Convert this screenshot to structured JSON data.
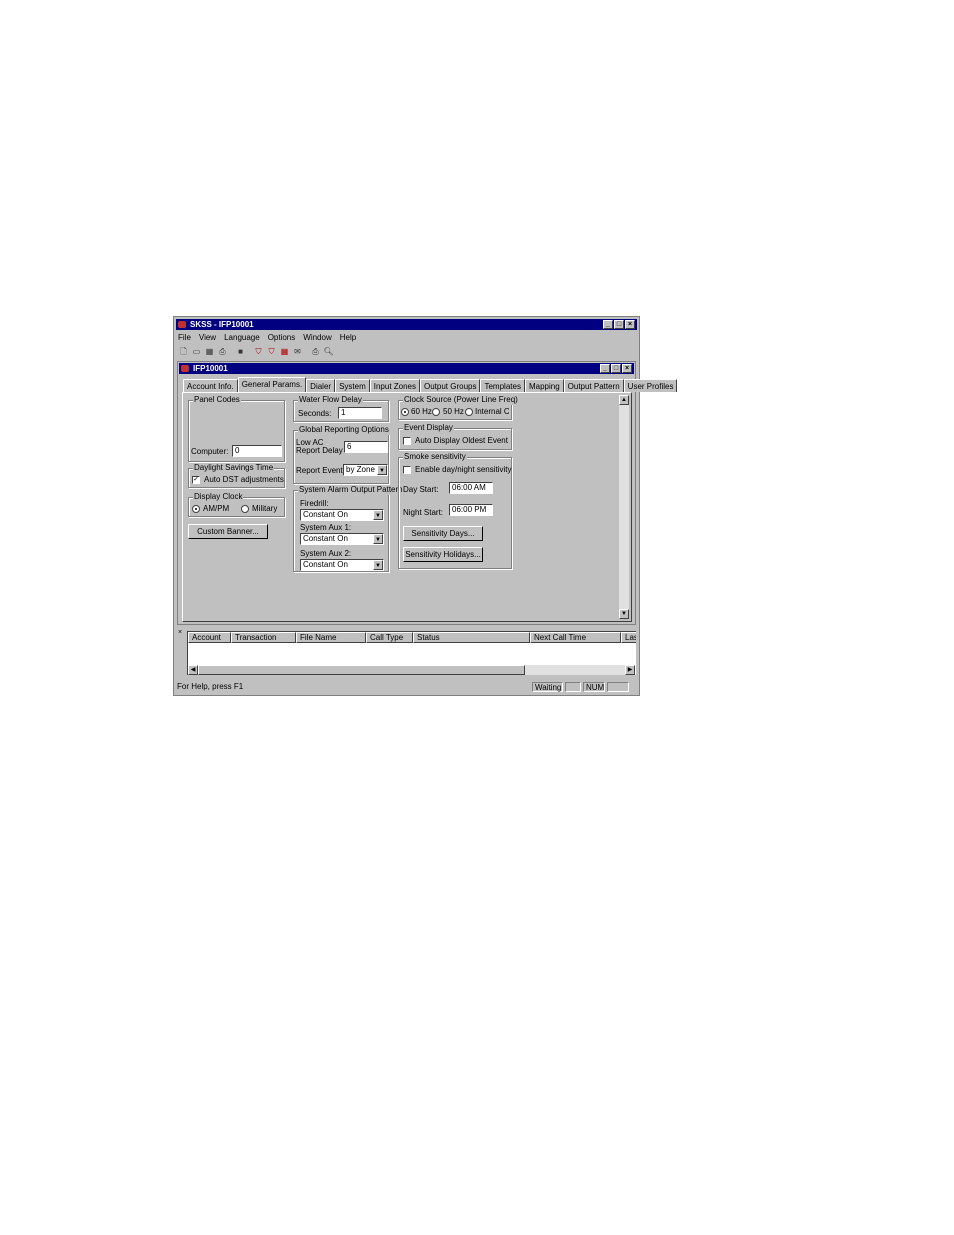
{
  "app": {
    "title": "SKSS - IFP10001",
    "window_buttons": [
      "_",
      "□",
      "×"
    ]
  },
  "menu": [
    "File",
    "View",
    "Language",
    "Options",
    "Window",
    "Help"
  ],
  "child": {
    "title": "IFP10001",
    "tabs": [
      "Account Info.",
      "General Params.",
      "Dialer",
      "System",
      "Input Zones",
      "Output Groups",
      "Templates",
      "Mapping",
      "Output Pattern",
      "User Profiles"
    ],
    "active_tab": "General Params."
  },
  "panel_codes": {
    "title": "Panel Codes",
    "computer_label": "Computer:",
    "computer_value": "0"
  },
  "dst": {
    "title": "Daylight Savings Time",
    "auto_label": "Auto DST adjustments",
    "auto_checked": true
  },
  "display_clock": {
    "title": "Display Clock",
    "ampm_label": "AM/PM",
    "military_label": "Military",
    "selected": "AM/PM"
  },
  "custom_banner_label": "Custom Banner...",
  "water_flow": {
    "title": "Water Flow Delay",
    "seconds_label": "Seconds:",
    "seconds_value": "1"
  },
  "global_reporting": {
    "title": "Global Reporting Options",
    "low_ac_label_1": "Low AC",
    "low_ac_label_2": "Report Delay",
    "low_ac_value": "6",
    "report_events_label": "Report Events:",
    "report_events_value": "by Zone"
  },
  "alarm_pattern": {
    "title": "System Alarm Output Pattern",
    "firedrill_label": "Firedrill:",
    "firedrill_value": "Constant On",
    "aux1_label": "System Aux 1:",
    "aux1_value": "Constant On",
    "aux2_label": "System Aux 2:",
    "aux2_value": "Constant On"
  },
  "clock_source": {
    "title": "Clock Source (Power Line Freq)",
    "opt_60": "60 Hz",
    "opt_50": "50 Hz",
    "opt_internal": "Internal Clk",
    "selected": "60 Hz"
  },
  "event_display": {
    "title": "Event Display",
    "auto_oldest_label": "Auto Display Oldest Event",
    "auto_oldest_checked": false
  },
  "smoke": {
    "title": "Smoke sensitivity",
    "enable_label": "Enable day/night sensitivity",
    "enable_checked": false,
    "day_start_label": "Day Start:",
    "day_start_value": "06:00 AM",
    "night_start_label": "Night Start:",
    "night_start_value": "06:00 PM",
    "days_button": "Sensitivity Days...",
    "holidays_button": "Sensitivity Holidays..."
  },
  "log": {
    "close": "×",
    "columns": [
      "Account",
      "Transaction",
      "File Name",
      "Call Type",
      "Status",
      "Next Call Time",
      "Las"
    ]
  },
  "status": {
    "help_text": "For Help, press F1",
    "state": "Waiting",
    "num": "NUM"
  }
}
